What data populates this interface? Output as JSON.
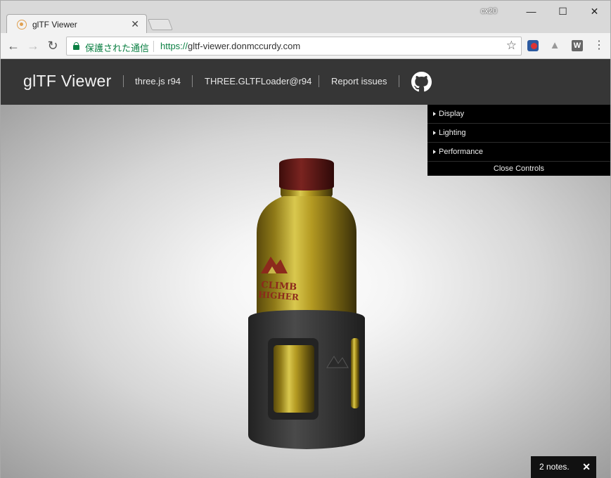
{
  "browser": {
    "tab_title": "glTF Viewer",
    "tab_close": "✕",
    "profile_label": "cx20",
    "window_controls": {
      "minimize": "—",
      "maximize": "☐",
      "close": "✕"
    },
    "nav": {
      "back": "←",
      "forward": "→",
      "reload": "↻"
    },
    "omnibox": {
      "secure_label": "保護された通信",
      "url_scheme": "https://",
      "url_host": "gltf-viewer.donmccurdy.com"
    },
    "extensions": [
      "shield-extension-icon",
      "hat-extension-icon",
      "w-extension-icon"
    ],
    "extension_w_label": "W",
    "menu_glyph": "⋮"
  },
  "app": {
    "title": "glTF Viewer",
    "links": {
      "threejs": "three.js r94",
      "loader": "THREE.GLTFLoader@r94",
      "report": "Report issues"
    },
    "controls": {
      "folders": [
        "Display",
        "Lighting",
        "Performance"
      ],
      "close_label": "Close Controls"
    },
    "model_label": {
      "line1": "CLIMB",
      "line2": "HIGHER"
    },
    "notes": {
      "label": "2 notes.",
      "close": "✕"
    }
  },
  "colors": {
    "header_bg": "#363636",
    "secure_green": "#0b8043",
    "cap_red": "#6a1a16",
    "bottle_gold": "#a88f1f"
  }
}
